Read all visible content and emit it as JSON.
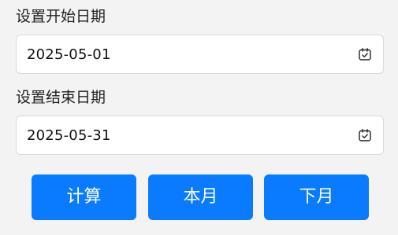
{
  "form": {
    "start_label": "设置开始日期",
    "start_value": "2025-05-01",
    "end_label": "设置结束日期",
    "end_value": "2025-05-31",
    "calendar_icon": "calendar-icon"
  },
  "buttons": {
    "calc_label": "计算",
    "this_month_label": "本月",
    "next_month_label": "下月",
    "color": "#0a7bff"
  }
}
